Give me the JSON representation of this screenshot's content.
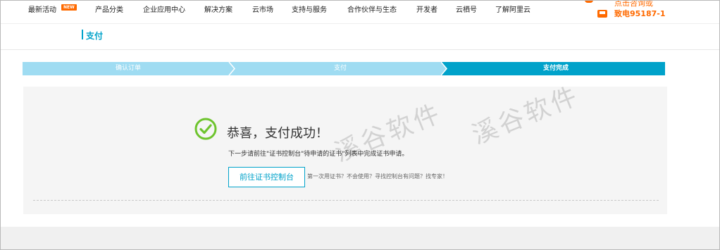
{
  "topnav": {
    "items": [
      "最新活动",
      "产品分类",
      "企业应用中心",
      "解决方案",
      "云市场",
      "支持与服务",
      "合作伙伴与生态",
      "开发者",
      "云栖号",
      "了解阿里云"
    ],
    "new_badge": "NEW",
    "contact_line1": "点击咨询或",
    "contact_line2": "致电95187-1"
  },
  "page_title": "支付",
  "steps": [
    "确认订单",
    "支付",
    "支付完成"
  ],
  "success": {
    "title": "恭喜，支付成功！",
    "next_step": "下一步请前往\"证书控制台\"待申请的证书\"列表中完成证书申请。",
    "button_label": "前往证书控制台",
    "help_text": "第一次用证书？不会使用？寻找控制台有问题？找专家！"
  },
  "watermark": "溪谷软件",
  "colors": {
    "accent": "#00a2ca",
    "step_inactive": "#9fdcf2",
    "success_green": "#6ec42e",
    "orange": "#ff6a00"
  }
}
